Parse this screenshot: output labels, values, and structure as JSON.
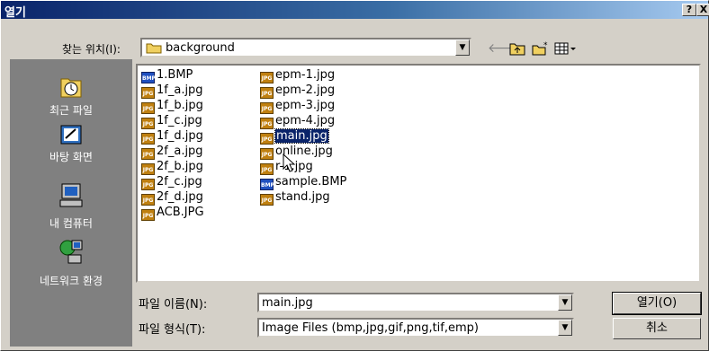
{
  "title": "열기",
  "title_buttons": {
    "help": "?",
    "close": "X"
  },
  "look_in": {
    "label": "찾는 위치(I):",
    "value": "background"
  },
  "toolbar": {
    "back_icon": "back-arrow-icon",
    "up_icon": "up-folder-icon",
    "new_folder_icon": "new-folder-icon",
    "view_icon": "view-menu-icon"
  },
  "places": [
    {
      "label": "최근 파일",
      "icon": "recent-icon"
    },
    {
      "label": "바탕 화면",
      "icon": "desktop-icon"
    },
    {
      "label": "내 컴퓨터",
      "icon": "my-computer-icon"
    },
    {
      "label": "네트워크 환경",
      "icon": "network-icon"
    }
  ],
  "files_col1": [
    {
      "name": "1.BMP",
      "type": "bmp"
    },
    {
      "name": "1f_a.jpg",
      "type": "jpg"
    },
    {
      "name": "1f_b.jpg",
      "type": "jpg"
    },
    {
      "name": "1f_c.jpg",
      "type": "jpg"
    },
    {
      "name": "1f_d.jpg",
      "type": "jpg"
    },
    {
      "name": "2f_a.jpg",
      "type": "jpg"
    },
    {
      "name": "2f_b.jpg",
      "type": "jpg"
    },
    {
      "name": "2f_c.jpg",
      "type": "jpg"
    },
    {
      "name": "2f_d.jpg",
      "type": "jpg"
    },
    {
      "name": "ACB.JPG",
      "type": "jpg"
    }
  ],
  "files_col2": [
    {
      "name": "epm-1.jpg",
      "type": "jpg"
    },
    {
      "name": "epm-2.jpg",
      "type": "jpg"
    },
    {
      "name": "epm-3.jpg",
      "type": "jpg"
    },
    {
      "name": "epm-4.jpg",
      "type": "jpg"
    },
    {
      "name": "main.jpg",
      "type": "jpg",
      "selected": true
    },
    {
      "name": "online.jpg",
      "type": "jpg"
    },
    {
      "name": "r-1.jpg",
      "type": "jpg"
    },
    {
      "name": "sample.BMP",
      "type": "bmp"
    },
    {
      "name": "stand.jpg",
      "type": "jpg"
    }
  ],
  "file_name": {
    "label": "파일 이름(N):",
    "value": "main.jpg"
  },
  "file_type": {
    "label": "파일 형식(T):",
    "value": "Image Files (bmp,jpg,gif,png,tif,emp)"
  },
  "buttons": {
    "open": "열기(O)",
    "cancel": "취소"
  }
}
